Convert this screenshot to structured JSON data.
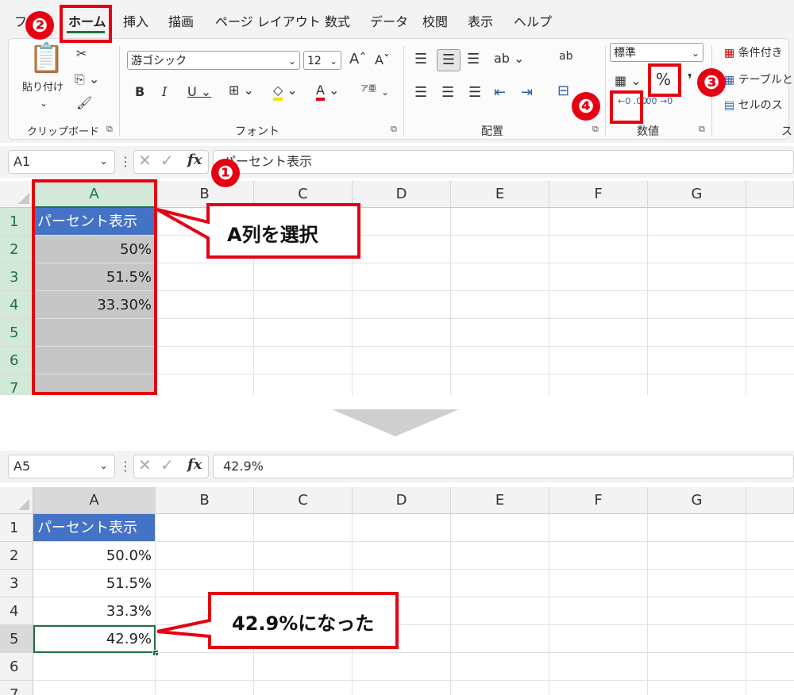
{
  "ribbon": {
    "tabs": [
      {
        "label": "ホーム",
        "active": true
      },
      {
        "label": "挿入"
      },
      {
        "label": "描画"
      },
      {
        "label": "ページ レイアウト"
      },
      {
        "label": "数式"
      },
      {
        "label": "データ"
      },
      {
        "label": "校閲"
      },
      {
        "label": "表示"
      },
      {
        "label": "ヘルプ"
      }
    ],
    "clipboard": {
      "paste_label": "貼り付け",
      "group_label": "クリップボード"
    },
    "font": {
      "font_name": "游ゴシック",
      "font_size": "12",
      "group_label": "フォント",
      "phonetic": "ア亜"
    },
    "alignment": {
      "wrap_label": "ab",
      "group_label": "配置"
    },
    "number": {
      "format": "標準",
      "percent_label": "%",
      "increase_decimal": "←0 .00",
      "decrease_decimal": ".00 →0",
      "group_label": "数値"
    },
    "styles": {
      "conditional": "条件付き",
      "table": "テーブルと",
      "cell_style": "セルのス",
      "group_label": "ス"
    }
  },
  "top": {
    "name_box": "A1",
    "formula": "パーセント表示",
    "columns": [
      "A",
      "B",
      "C",
      "D",
      "E",
      "F",
      "G"
    ],
    "rows": [
      "1",
      "2",
      "3",
      "4",
      "5",
      "6",
      "7"
    ],
    "cells": [
      "パーセント表示",
      "50%",
      "51.5%",
      "33.30%",
      "",
      "",
      ""
    ]
  },
  "bottom": {
    "name_box": "A5",
    "formula": "42.9%",
    "columns": [
      "A",
      "B",
      "C",
      "D",
      "E",
      "F",
      "G"
    ],
    "rows": [
      "1",
      "2",
      "3",
      "4",
      "5",
      "6",
      "7"
    ],
    "cells": [
      "パーセント表示",
      "50.0%",
      "51.5%",
      "33.3%",
      "42.9%",
      "",
      ""
    ]
  },
  "annotations": {
    "badges": [
      "❶",
      "❷",
      "❸",
      "❹"
    ],
    "callout_select": "A列を選択",
    "callout_result": "42.9%になった"
  },
  "colors": {
    "accent_red": "#e60012",
    "excel_green": "#1e7145",
    "header_blue": "#4472c4",
    "arrow_gray": "#cfcfcf"
  }
}
